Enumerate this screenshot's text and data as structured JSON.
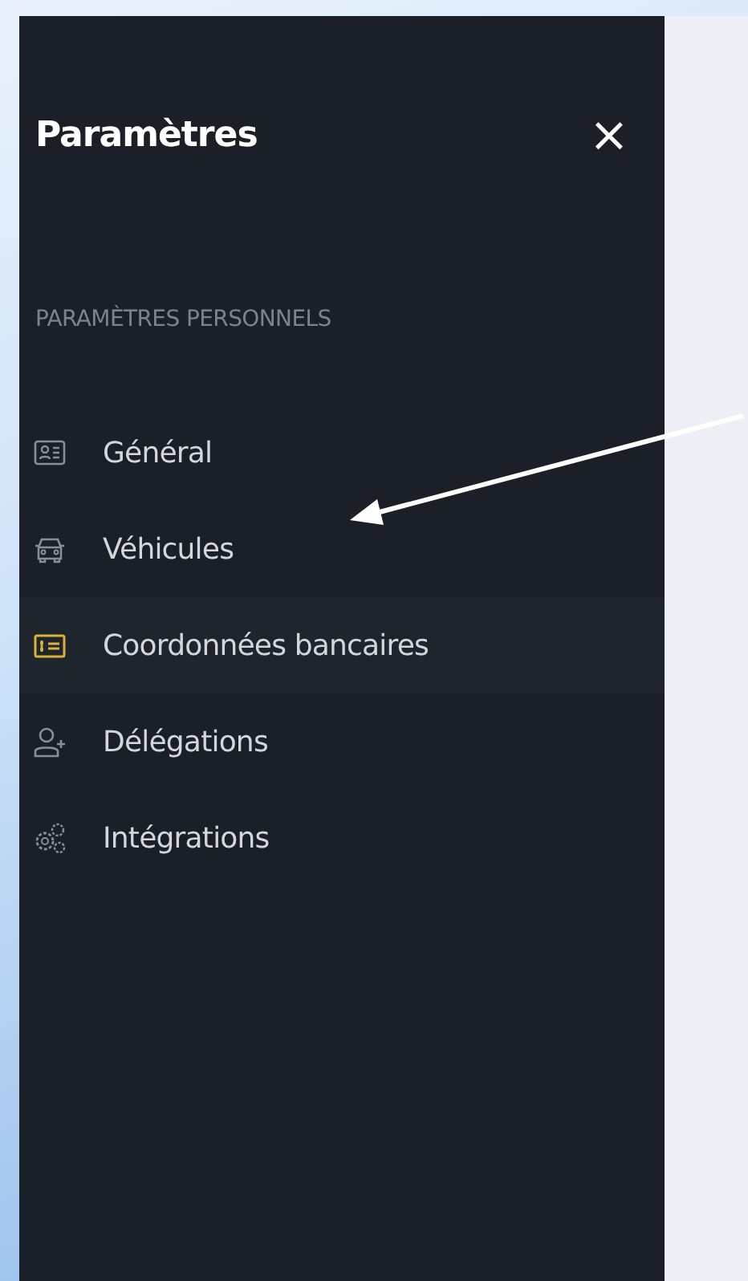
{
  "panel": {
    "title": "Paramètres",
    "close": "×"
  },
  "section": {
    "heading": "PARAMÈTRES PERSONNELS",
    "items": [
      {
        "label": "Général",
        "selected": false
      },
      {
        "label": "Véhicules",
        "selected": false
      },
      {
        "label": "Coordonnées bancaires",
        "selected": true
      },
      {
        "label": "Délégations",
        "selected": false
      },
      {
        "label": "Intégrations",
        "selected": false
      }
    ]
  }
}
